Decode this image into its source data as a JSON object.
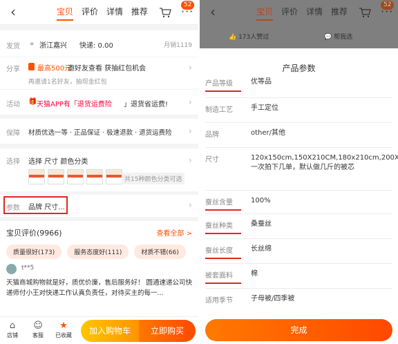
{
  "left": {
    "tabs": [
      "宝贝",
      "评价",
      "详情",
      "推荐"
    ],
    "badge": "52",
    "shipping": {
      "label": "发货",
      "location": "浙江嘉兴",
      "express": "快递: 0.00",
      "monthly": "月销1119"
    },
    "share": {
      "label": "分享",
      "highlight": "最高500元",
      "main": "邀好友查看 获抽红包机会",
      "sub": "再邀请1名好友，抽现金红包"
    },
    "activity": {
      "label": "活动",
      "promo_a": "天猫APP有「退货运费险",
      "promo_b": "」退货省运费!"
    },
    "guarantee": {
      "label": "保障",
      "text": "材质优选一等 · 正品保证 · 极速退款 · 退货运费险"
    },
    "select": {
      "label": "选择",
      "text": "选择 尺寸 颜色分类",
      "count": "共15种颜色分类可选",
      "thumb_count": 5
    },
    "param": {
      "label": "参数",
      "text": "品牌 尺寸..."
    },
    "reviews": {
      "title": "宝贝评价(9966)",
      "view_all": "查看全部 >",
      "chips": [
        "质量很好(173)",
        "服务态度好(111)",
        "材质不错(66)"
      ],
      "user": "t**5",
      "body": "天猫商城购物就是好，质优价廉，售后服务好！ 圆通速递公司快递师付小王对快递工作认真负责任，对待买主的每一...",
      "cut": "宝贝评价"
    },
    "bottom": {
      "store": "店铺",
      "service": "客服",
      "fav": "已收藏",
      "cart": "加入购物车",
      "buy": "立即购买"
    }
  },
  "right": {
    "tabs": [
      "宝贝",
      "评价",
      "详情",
      "推荐"
    ],
    "badge": "52",
    "like": "173人赞过",
    "ask": "帮我选",
    "sheet_title": "产品参数",
    "params": [
      {
        "k": "产品等级",
        "v": "优等品",
        "hl": true
      },
      {
        "k": "制造工艺",
        "v": "手工定位",
        "hl": false
      },
      {
        "k": "品牌",
        "v": "other/其他",
        "hl": false
      },
      {
        "k": "尺寸",
        "v": "120x150cm,150X210CM,180x210cm,200X230cm,220x240cm,一次拍下几单，默认做几斤的被芯",
        "hl": false
      },
      {
        "k": "蚕丝含量",
        "v": "100%",
        "hl": true
      },
      {
        "k": "蚕丝种类",
        "v": "桑蚕丝",
        "hl": true
      },
      {
        "k": "蚕丝长度",
        "v": "长丝绵",
        "hl": true
      },
      {
        "k": "被套面料",
        "v": "棉",
        "hl": true
      },
      {
        "k": "适用季节",
        "v": "子母被/四季被",
        "hl": false
      }
    ],
    "done": "完成"
  },
  "colors": {
    "accent": "#ff5000",
    "highlight_box": "#e1251b"
  }
}
